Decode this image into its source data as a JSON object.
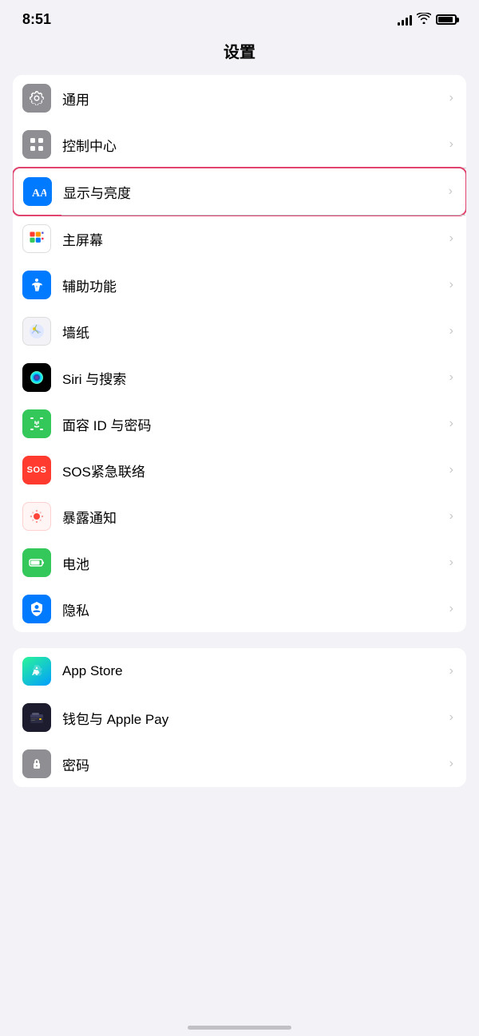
{
  "statusBar": {
    "time": "8:51",
    "battery": "full"
  },
  "pageTitle": "设置",
  "sections": [
    {
      "id": "section1",
      "items": [
        {
          "id": "general",
          "label": "通用",
          "icon": "gear",
          "iconBg": "icon-gray",
          "highlighted": false
        },
        {
          "id": "control-center",
          "label": "控制中心",
          "icon": "control",
          "iconBg": "icon-gray2",
          "highlighted": false
        },
        {
          "id": "display",
          "label": "显示与亮度",
          "icon": "display",
          "iconBg": "icon-blue",
          "highlighted": true
        },
        {
          "id": "homescreen",
          "label": "主屏幕",
          "icon": "homescreen",
          "iconBg": "icon-colorful",
          "highlighted": false
        },
        {
          "id": "accessibility",
          "label": "辅助功能",
          "icon": "accessibility",
          "iconBg": "icon-teal",
          "highlighted": false
        },
        {
          "id": "wallpaper",
          "label": "墙纸",
          "icon": "wallpaper",
          "iconBg": "icon-flower",
          "highlighted": false
        },
        {
          "id": "siri",
          "label": "Siri 与搜索",
          "icon": "siri",
          "iconBg": "icon-siri",
          "highlighted": false
        },
        {
          "id": "faceid",
          "label": "面容 ID 与密码",
          "icon": "faceid",
          "iconBg": "icon-face",
          "highlighted": false
        },
        {
          "id": "sos",
          "label": "SOS紧急联络",
          "icon": "sos",
          "iconBg": "icon-sos",
          "highlighted": false
        },
        {
          "id": "exposure",
          "label": "暴露通知",
          "icon": "exposure",
          "iconBg": "icon-exposure",
          "highlighted": false
        },
        {
          "id": "battery",
          "label": "电池",
          "icon": "battery",
          "iconBg": "icon-battery",
          "highlighted": false
        },
        {
          "id": "privacy",
          "label": "隐私",
          "icon": "privacy",
          "iconBg": "icon-privacy",
          "highlighted": false
        }
      ]
    },
    {
      "id": "section2",
      "items": [
        {
          "id": "appstore",
          "label": "App Store",
          "icon": "appstore",
          "iconBg": "icon-appstore",
          "highlighted": false
        },
        {
          "id": "wallet",
          "label": "钱包与 Apple Pay",
          "icon": "wallet",
          "iconBg": "icon-wallet",
          "highlighted": false
        },
        {
          "id": "password",
          "label": "密码",
          "icon": "password",
          "iconBg": "icon-password",
          "highlighted": false
        }
      ]
    }
  ]
}
